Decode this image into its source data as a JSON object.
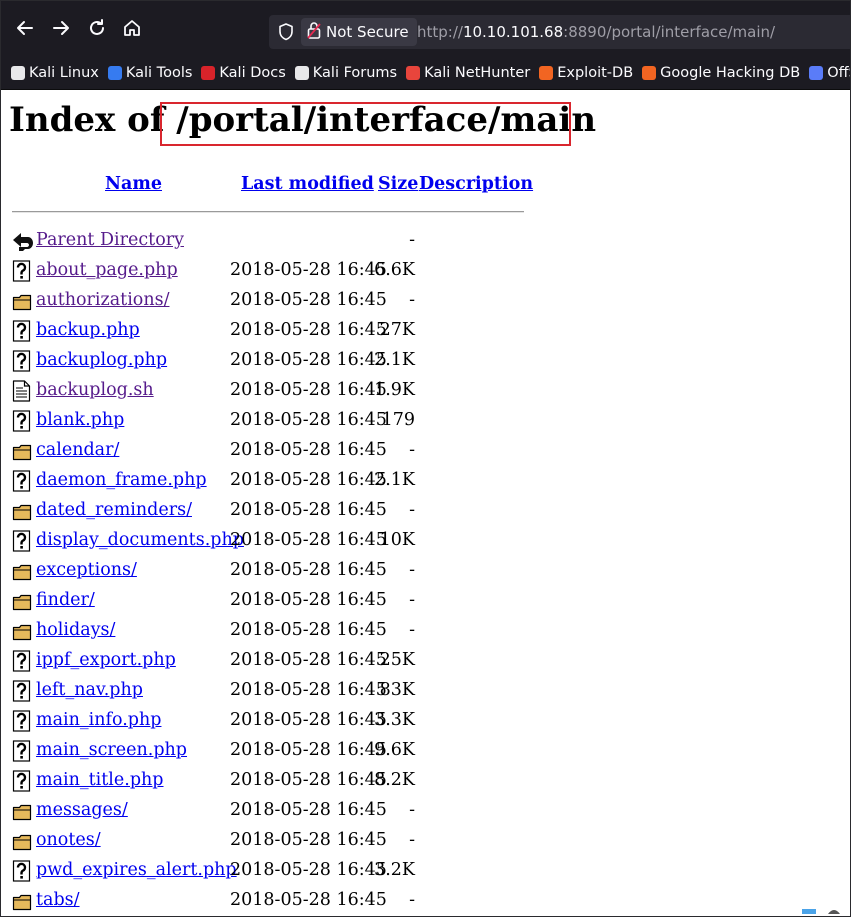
{
  "browser": {
    "security_label": "Not Secure",
    "url_prefix": "http://",
    "url_host": "10.10.101.68",
    "url_rest": ":8890/portal/interface/main/",
    "bookmarks": [
      {
        "label": "Kali Linux",
        "icon": "kali-dragon-icon",
        "color": "#e8e8ea"
      },
      {
        "label": "Kali Tools",
        "icon": "kali-tools-icon",
        "color": "#367bf0"
      },
      {
        "label": "Kali Docs",
        "icon": "kali-docs-icon",
        "color": "#d8232a"
      },
      {
        "label": "Kali Forums",
        "icon": "kali-dragon-icon",
        "color": "#e8e8ea"
      },
      {
        "label": "Kali NetHunter",
        "icon": "nethunter-icon",
        "color": "#e8453c"
      },
      {
        "label": "Exploit-DB",
        "icon": "exploit-db-icon",
        "color": "#f26522"
      },
      {
        "label": "Google Hacking DB",
        "icon": "ghdb-icon",
        "color": "#f26522"
      },
      {
        "label": "OffSe",
        "icon": "offsec-icon",
        "color": "#5a7cf8"
      }
    ]
  },
  "page": {
    "title_prefix": "Index of ",
    "title_path": "/portal/interface/main",
    "headers": {
      "name": "Name",
      "modified": "Last modified",
      "size": "Size",
      "description": "Description"
    },
    "entries": [
      {
        "name": "Parent Directory",
        "modified": "",
        "size": "-",
        "icon": "back-arrow-icon",
        "visited": true
      },
      {
        "name": "about_page.php",
        "modified": "2018-05-28 16:45",
        "size": "6.6K",
        "icon": "unknown-file-icon",
        "visited": true
      },
      {
        "name": "authorizations/",
        "modified": "2018-05-28 16:45",
        "size": "-",
        "icon": "folder-icon",
        "visited": true
      },
      {
        "name": "backup.php",
        "modified": "2018-05-28 16:45",
        "size": "27K",
        "icon": "unknown-file-icon",
        "visited": false
      },
      {
        "name": "backuplog.php",
        "modified": "2018-05-28 16:45",
        "size": "2.1K",
        "icon": "unknown-file-icon",
        "visited": false
      },
      {
        "name": "backuplog.sh",
        "modified": "2018-05-28 16:45",
        "size": "1.9K",
        "icon": "text-file-icon",
        "visited": true
      },
      {
        "name": "blank.php",
        "modified": "2018-05-28 16:45",
        "size": "179",
        "icon": "unknown-file-icon",
        "visited": false
      },
      {
        "name": "calendar/",
        "modified": "2018-05-28 16:45",
        "size": "-",
        "icon": "folder-icon",
        "visited": false
      },
      {
        "name": "daemon_frame.php",
        "modified": "2018-05-28 16:45",
        "size": "2.1K",
        "icon": "unknown-file-icon",
        "visited": false
      },
      {
        "name": "dated_reminders/",
        "modified": "2018-05-28 16:45",
        "size": "-",
        "icon": "folder-icon",
        "visited": false
      },
      {
        "name": "display_documents.php",
        "modified": "2018-05-28 16:45",
        "size": "10K",
        "icon": "unknown-file-icon",
        "visited": false
      },
      {
        "name": "exceptions/",
        "modified": "2018-05-28 16:45",
        "size": "-",
        "icon": "folder-icon",
        "visited": false
      },
      {
        "name": "finder/",
        "modified": "2018-05-28 16:45",
        "size": "-",
        "icon": "folder-icon",
        "visited": false
      },
      {
        "name": "holidays/",
        "modified": "2018-05-28 16:45",
        "size": "-",
        "icon": "folder-icon",
        "visited": false
      },
      {
        "name": "ippf_export.php",
        "modified": "2018-05-28 16:45",
        "size": "25K",
        "icon": "unknown-file-icon",
        "visited": false
      },
      {
        "name": "left_nav.php",
        "modified": "2018-05-28 16:45",
        "size": "83K",
        "icon": "unknown-file-icon",
        "visited": false
      },
      {
        "name": "main_info.php",
        "modified": "2018-05-28 16:45",
        "size": "3.3K",
        "icon": "unknown-file-icon",
        "visited": false
      },
      {
        "name": "main_screen.php",
        "modified": "2018-05-28 16:45",
        "size": "9.6K",
        "icon": "unknown-file-icon",
        "visited": false
      },
      {
        "name": "main_title.php",
        "modified": "2018-05-28 16:45",
        "size": "8.2K",
        "icon": "unknown-file-icon",
        "visited": false
      },
      {
        "name": "messages/",
        "modified": "2018-05-28 16:45",
        "size": "-",
        "icon": "folder-icon",
        "visited": false
      },
      {
        "name": "onotes/",
        "modified": "2018-05-28 16:45",
        "size": "-",
        "icon": "folder-icon",
        "visited": false
      },
      {
        "name": "pwd_expires_alert.php",
        "modified": "2018-05-28 16:45",
        "size": "3.2K",
        "icon": "unknown-file-icon",
        "visited": false
      },
      {
        "name": "tabs/",
        "modified": "2018-05-28 16:45",
        "size": "-",
        "icon": "folder-icon",
        "visited": false
      }
    ]
  }
}
